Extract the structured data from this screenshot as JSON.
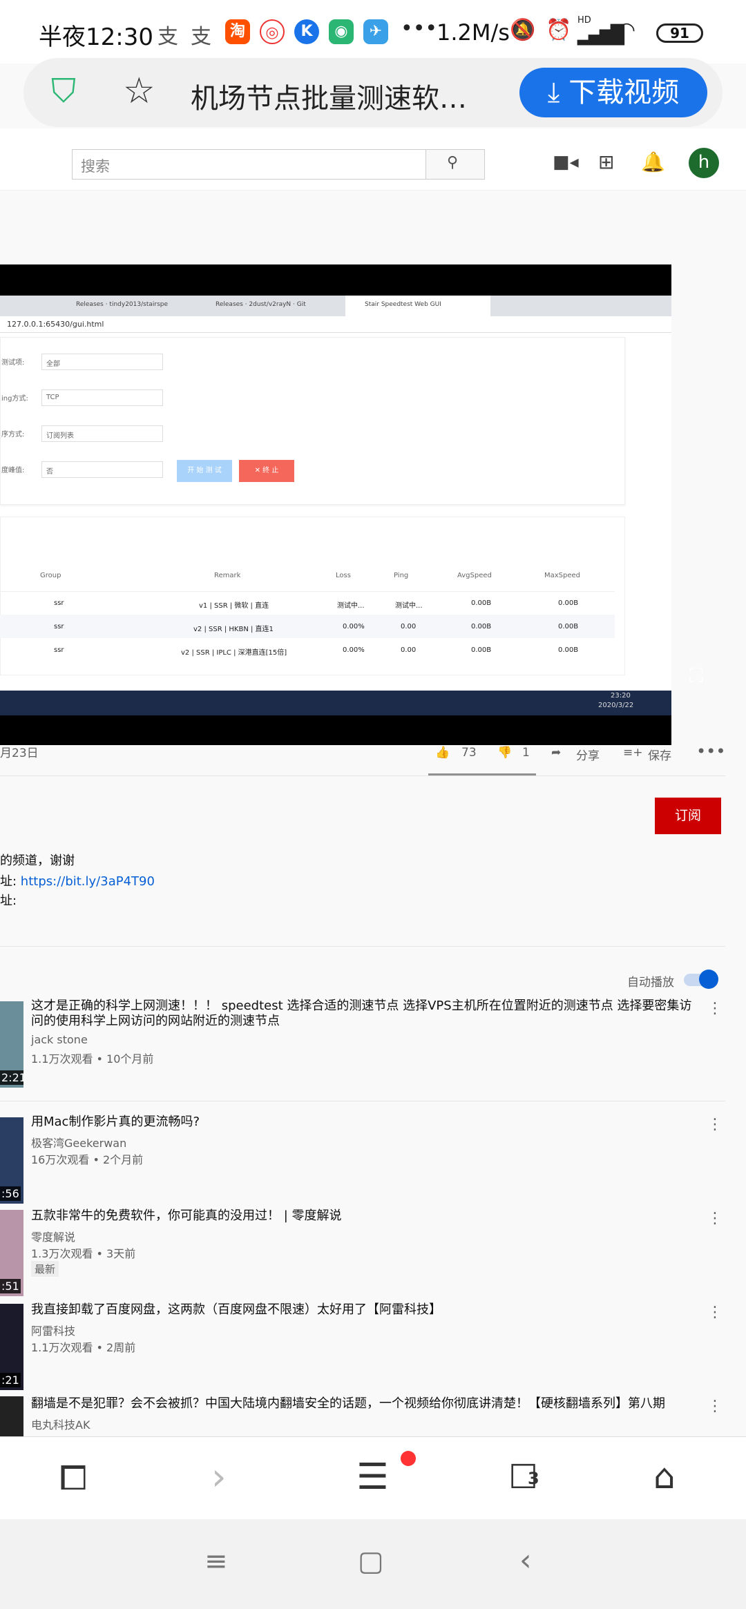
{
  "status_bar": {
    "time": "半夜12:30",
    "net_speed": "1.2M/s",
    "battery": "91",
    "hd_label": "HD"
  },
  "browser": {
    "tab_title": "机场节点批量测速软…",
    "download_label": "下载视频",
    "tabs_count": "3"
  },
  "youtube": {
    "search_placeholder": "搜索",
    "avatar_letter": "h",
    "date_fragment": "月23日",
    "likes": "73",
    "dislikes": "1",
    "share_label": "分享",
    "save_label": "保存",
    "subscribe_label": "订阅",
    "autoplay_label": "自动播放",
    "description_lines": [
      {
        "prefix": "的频道，谢谢",
        "link": ""
      },
      {
        "prefix": "址: ",
        "link": "https://bit.ly/3aP4T90"
      },
      {
        "prefix": "址:",
        "link": ""
      }
    ]
  },
  "embedded_screen": {
    "browser_tabs": [
      "Releases · tindy2013/stairspe",
      "Releases · 2dust/v2rayN · Git",
      "Stair Speedtest Web GUI"
    ],
    "address": "127.0.0.1:65430/gui.html",
    "form_rows": [
      {
        "label": "测试项:",
        "value": "全部"
      },
      {
        "label": "ing方式:",
        "value": "TCP"
      },
      {
        "label": "序方式:",
        "value": "订阅列表"
      },
      {
        "label": "度峰值:",
        "value": "否"
      }
    ],
    "start_btn": "开 始 测 试",
    "stop_btn": "✕ 终 止",
    "table_headers": [
      "Group",
      "Remark",
      "Loss",
      "Ping",
      "AvgSpeed",
      "MaxSpeed"
    ],
    "table_rows": [
      [
        "ssr",
        "v1 | SSR | 微软 | 直连",
        "测试中...",
        "测试中...",
        "0.00B",
        "0.00B"
      ],
      [
        "ssr",
        "v2 | SSR | HKBN | 直连1",
        "0.00%",
        "0.00",
        "0.00B",
        "0.00B"
      ],
      [
        "ssr",
        "v2 | SSR | IPLC | 深港直连[15倍]",
        "0.00%",
        "0.00",
        "0.00B",
        "0.00B"
      ]
    ],
    "clock_time": "23:20",
    "clock_date": "2020/3/22"
  },
  "videos": [
    {
      "title": "这才是正确的科学上网测速！！！ speedtest 选择合适的测速节点 选择VPS主机所在位置附近的测速节点 选择要密集访问的使用科学上网访问的网站附近的测速节点",
      "channel": "jack stone",
      "meta": "1.1万次观看 • 10个月前",
      "duration": "2:21",
      "badge": ""
    },
    {
      "title": "用Mac制作影片真的更流畅吗?",
      "channel": "极客湾Geekerwan",
      "meta": "16万次观看 • 2个月前",
      "duration": ":56",
      "badge": ""
    },
    {
      "title": "五款非常牛的免费软件，你可能真的没用过！ | 零度解说",
      "channel": "零度解说",
      "meta": "1.3万次观看 • 3天前",
      "duration": ":51",
      "badge": "最新"
    },
    {
      "title": "我直接卸载了百度网盘，这两款（百度网盘不限速）太好用了【阿雷科技】",
      "channel": "阿雷科技",
      "meta": "1.1万次观看 • 2周前",
      "duration": ":21",
      "badge": ""
    },
    {
      "title": "翻墙是不是犯罪？会不会被抓？中国大陆境内翻墙安全的话题，一个视频给你彻底讲清楚！【硬核翻墙系列】第八期",
      "channel": "电丸科技AK",
      "meta": "",
      "duration": "",
      "badge": ""
    }
  ]
}
